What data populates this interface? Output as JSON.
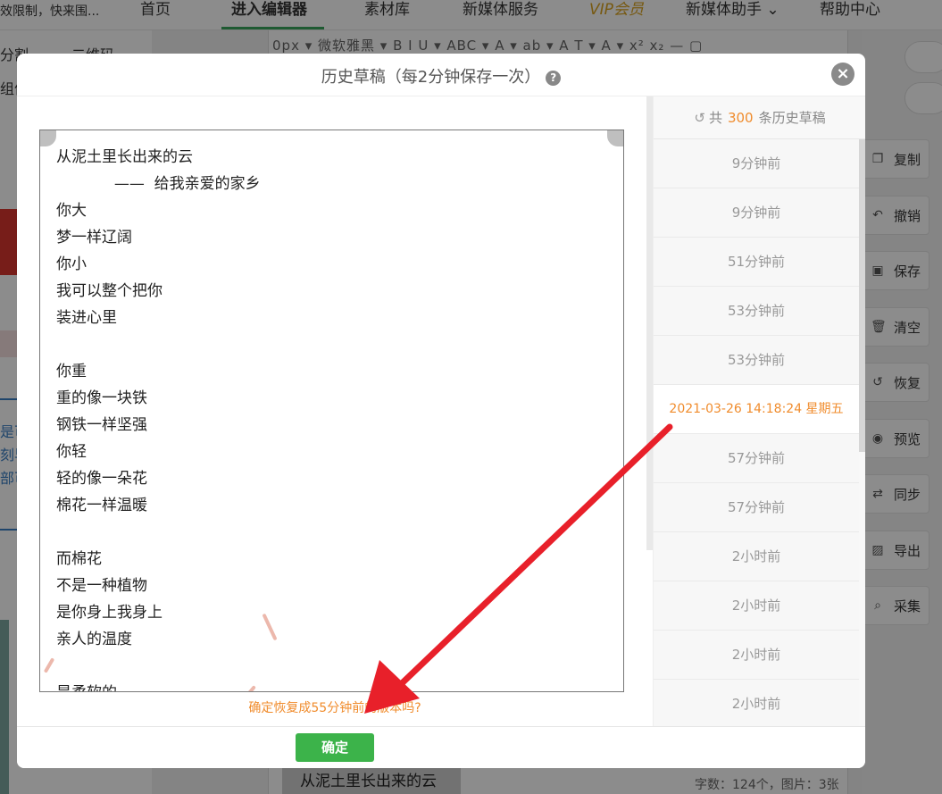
{
  "topnav": {
    "promo": "效限制，快来围...",
    "items": [
      "首页",
      "进入编辑器",
      "素材库",
      "新媒体服务",
      "VIP会员",
      "新媒体助手 ⌄",
      "帮助中心"
    ]
  },
  "left_panel": {
    "labels": [
      "分割",
      "二维码",
      "组件"
    ],
    "blue_texts": [
      "是可",
      "刻早",
      "部可"
    ]
  },
  "toolbar_text": "0px ▾  微软雅黑 ▾  B  I  U ▾  ABC ▾  A ▾  ab ▾  A  T ▾  A ▾  x²  x₂  —  ▢",
  "under_title": "从泥土里长出来的云",
  "word_count": "字数：124个，图片：3张",
  "right_tools": [
    {
      "label": "复制",
      "icon": "copy-icon"
    },
    {
      "label": "撤销",
      "icon": "undo-icon"
    },
    {
      "label": "保存",
      "icon": "save-icon"
    },
    {
      "label": "清空",
      "icon": "trash-icon"
    },
    {
      "label": "恢复",
      "icon": "restore-icon"
    },
    {
      "label": "预览",
      "icon": "eye-icon"
    },
    {
      "label": "同步",
      "icon": "sync-icon"
    },
    {
      "label": "导出",
      "icon": "image-export-icon"
    },
    {
      "label": "采集",
      "icon": "search-collect-icon"
    }
  ],
  "modal": {
    "title": "历史草稿（每2分钟保存一次）",
    "help_glyph": "?",
    "close_glyph": "×",
    "poem": "从泥土里长出来的云\n            ——  给我亲爱的家乡\n你大\n梦一样辽阔\n你小\n我可以整个把你\n装进心里\n\n你重\n重的像一块铁\n钢铁一样坚强\n你轻\n轻的像一朵花\n棉花一样温暖\n\n而棉花\n不是一种植物\n是你身上我身上\n亲人的温度\n\n是柔软的",
    "history_header": {
      "prefix": "共",
      "count": "300",
      "suffix": "条历史草稿",
      "icon": "history-icon"
    },
    "history_items": [
      "9分钟前",
      "9分钟前",
      "51分钟前",
      "53分钟前",
      "53分钟前",
      "2021-03-26 14:18:24 星期五",
      "57分钟前",
      "57分钟前",
      "2小时前",
      "2小时前",
      "2小时前",
      "2小时前"
    ],
    "selected_index": 5,
    "confirm_text": "确定恢复成55分钟前的版本吗?",
    "ok_label": "确定"
  },
  "colors": {
    "accent_orange": "#f08c2d",
    "ok_green": "#3cb34a",
    "arrow_red": "#e8202a",
    "nav_active_underline": "#3aa55b"
  }
}
